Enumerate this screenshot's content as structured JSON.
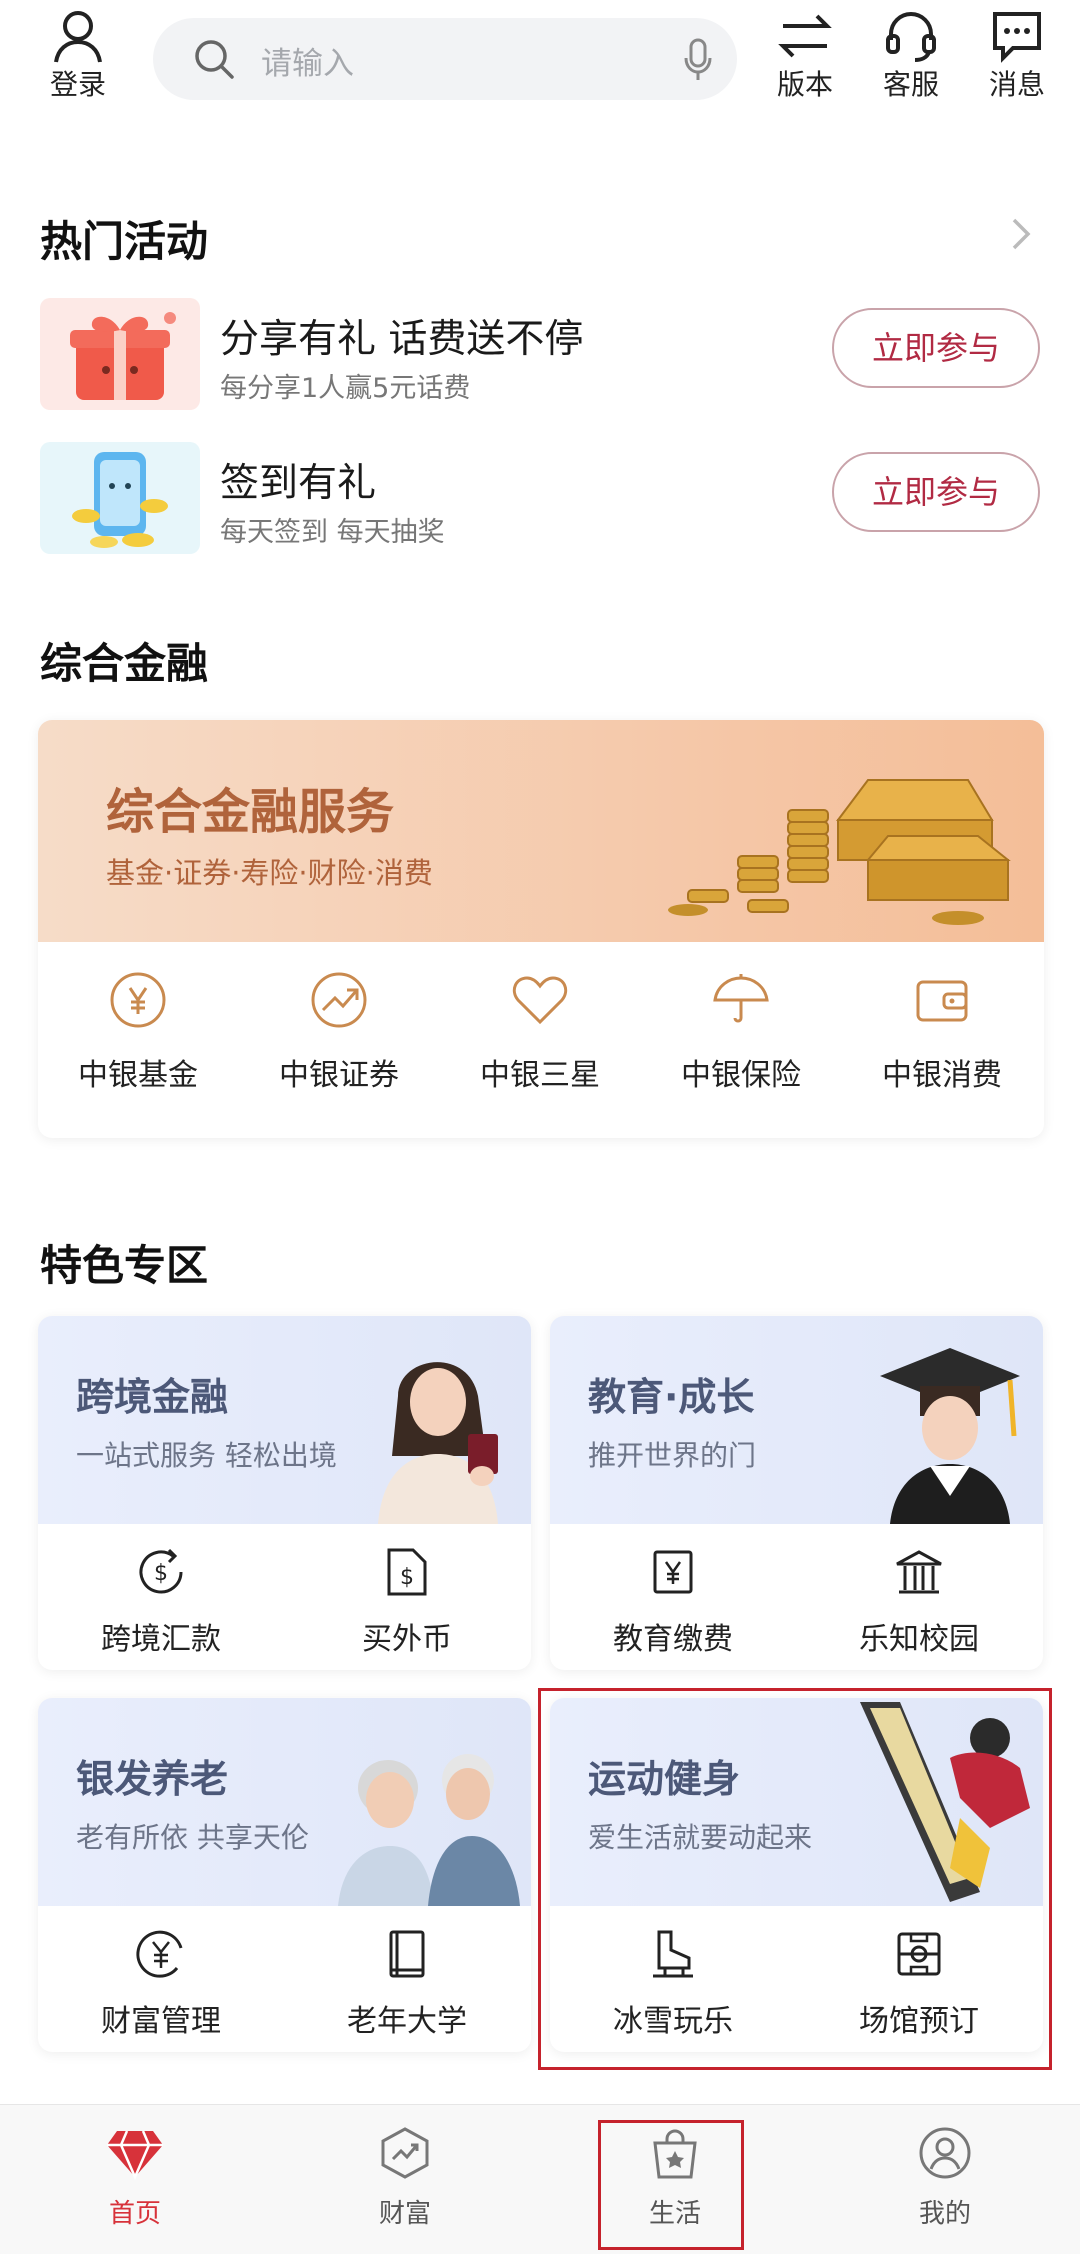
{
  "header": {
    "login_label": "登录",
    "search_placeholder": "请输入",
    "version_label": "版本",
    "service_label": "客服",
    "message_label": "消息"
  },
  "hot": {
    "title": "热门活动",
    "items": [
      {
        "title": "分享有礼 话费送不停",
        "subtitle": "每分享1人赢5元话费",
        "button": "立即参与"
      },
      {
        "title": "签到有礼",
        "subtitle": "每天签到 每天抽奖",
        "button": "立即参与"
      }
    ]
  },
  "finance": {
    "title": "综合金融",
    "banner_title": "综合金融服务",
    "banner_sub": "基金·证券·寿险·财险·消费",
    "items": [
      {
        "label": "中银基金",
        "icon": "yen-circle-icon"
      },
      {
        "label": "中银证券",
        "icon": "trend-circle-icon"
      },
      {
        "label": "中银三星",
        "icon": "heart-icon"
      },
      {
        "label": "中银保险",
        "icon": "umbrella-icon"
      },
      {
        "label": "中银消费",
        "icon": "wallet-icon"
      }
    ]
  },
  "featured": {
    "title": "特色专区",
    "cards": [
      {
        "title": "跨境金融",
        "subtitle": "一站式服务 轻松出境",
        "items": [
          "跨境汇款",
          "买外币"
        ]
      },
      {
        "title": "教育·成长",
        "subtitle": "推开世界的门",
        "items": [
          "教育缴费",
          "乐知校园"
        ]
      },
      {
        "title": "银发养老",
        "subtitle": "老有所依 共享天伦",
        "items": [
          "财富管理",
          "老年大学"
        ]
      },
      {
        "title": "运动健身",
        "subtitle": "爱生活就要动起来",
        "items": [
          "冰雪玩乐",
          "场馆预订"
        ]
      }
    ]
  },
  "tabbar": {
    "tabs": [
      "首页",
      "财富",
      "生活",
      "我的"
    ],
    "active_color": "#d7323a"
  },
  "colors": {
    "accent": "#b12a43",
    "highlight_box": "#c5222c"
  }
}
